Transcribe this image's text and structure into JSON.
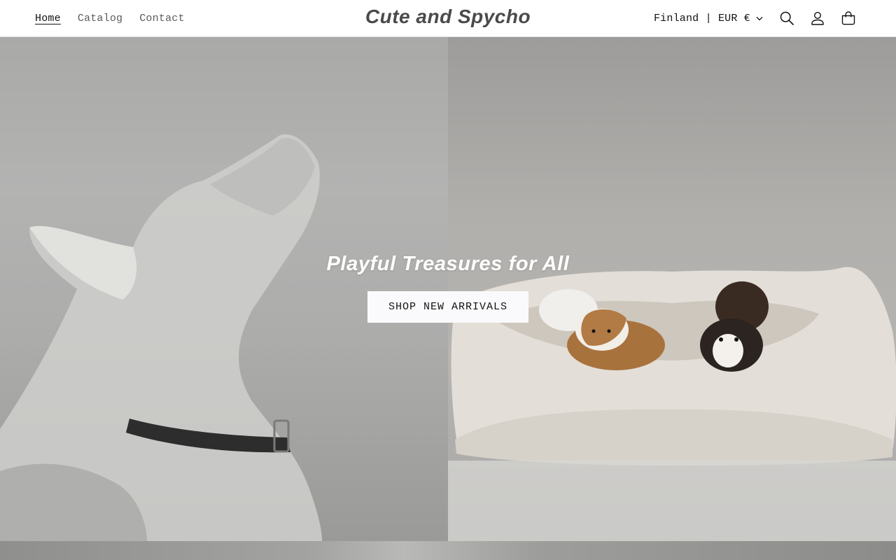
{
  "header": {
    "nav": [
      {
        "label": "Home",
        "active": true
      },
      {
        "label": "Catalog",
        "active": false
      },
      {
        "label": "Contact",
        "active": false
      }
    ],
    "logo": "Cute and Spycho",
    "locale": "Finland | EUR €",
    "icons": [
      "chevron-down-icon",
      "search-icon",
      "account-icon",
      "cart-icon"
    ]
  },
  "hero": {
    "title": "Playful Treasures for All",
    "button_label": "SHOP NEW ARRIVALS"
  },
  "colors": {
    "text": "#121212",
    "nav_muted": "#5c5c5c",
    "logo": "#4a4a4a",
    "button_bg": "#fafafc",
    "header_border": "#e2e2e2"
  }
}
